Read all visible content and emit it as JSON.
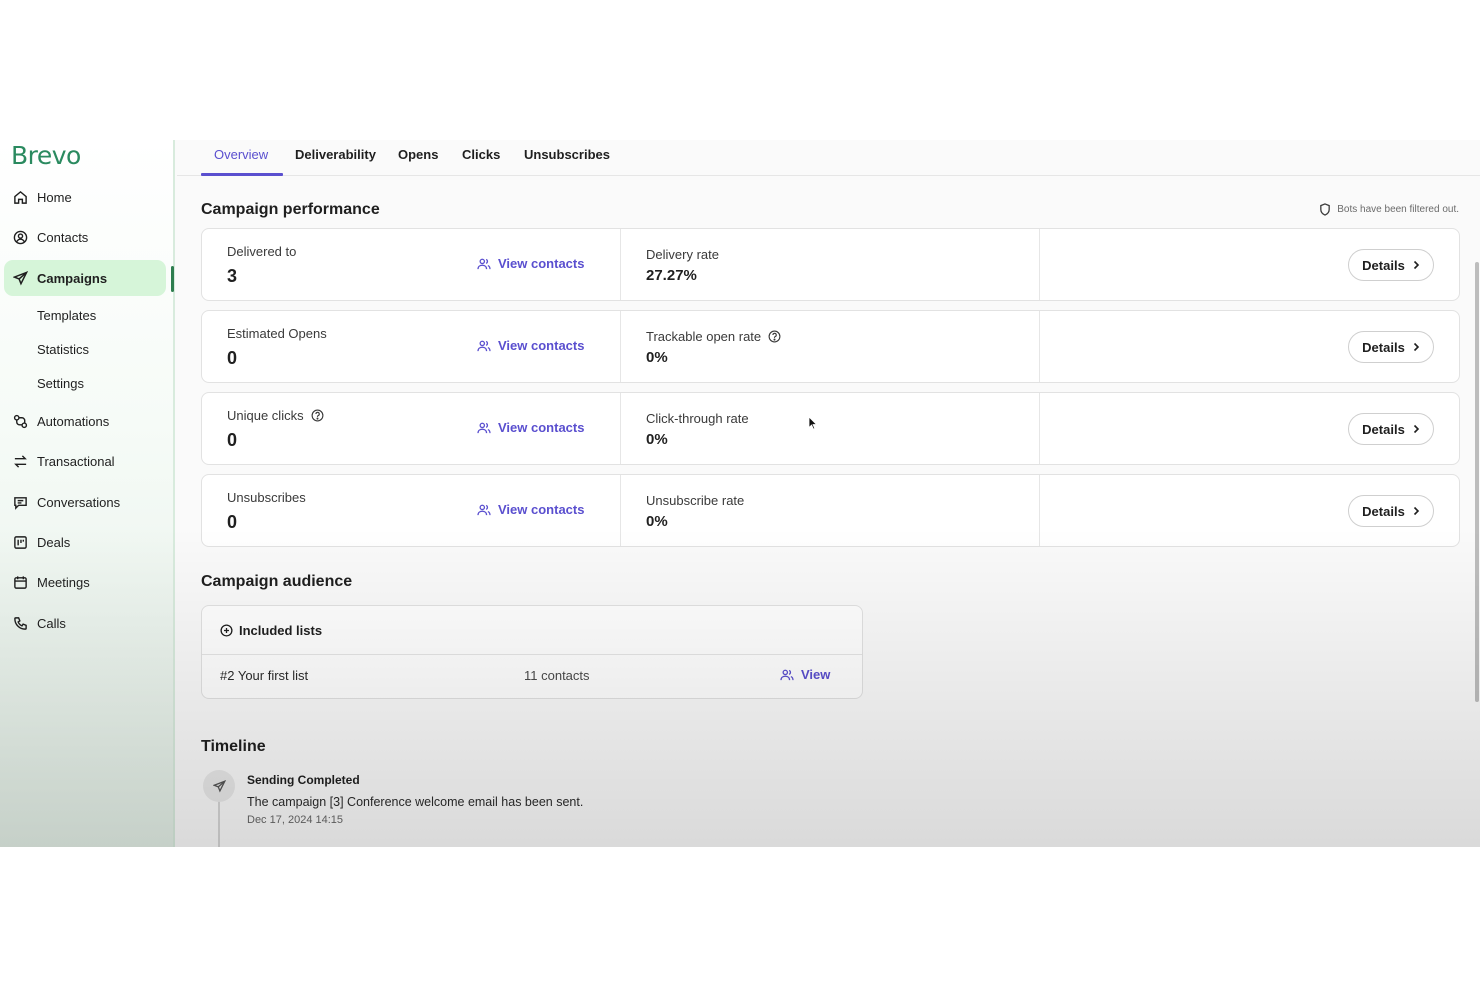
{
  "brand": {
    "logo_text": "Brevo",
    "color": "#2a8a5f"
  },
  "sidebar": {
    "items": [
      {
        "label": "Home",
        "icon": "home-icon"
      },
      {
        "label": "Contacts",
        "icon": "contacts-icon"
      },
      {
        "label": "Campaigns",
        "icon": "send-icon",
        "active": true
      },
      {
        "label": "Automations",
        "icon": "automations-icon"
      },
      {
        "label": "Transactional",
        "icon": "transactional-icon"
      },
      {
        "label": "Conversations",
        "icon": "conversations-icon"
      },
      {
        "label": "Deals",
        "icon": "deals-icon"
      },
      {
        "label": "Meetings",
        "icon": "calendar-icon"
      },
      {
        "label": "Calls",
        "icon": "phone-icon"
      }
    ],
    "sub_items": [
      "Templates",
      "Statistics",
      "Settings"
    ],
    "active_color": "#d6f5d9"
  },
  "tabs": [
    "Overview",
    "Deliverability",
    "Opens",
    "Clicks",
    "Unsubscribes"
  ],
  "accent_color": "#5a4fcf",
  "performance": {
    "title": "Campaign performance",
    "bots_note": "Bots have been filtered out.",
    "rows": [
      {
        "label": "Delivered to",
        "value": "3",
        "link": "View contacts",
        "rate_label": "Delivery rate",
        "rate_value": "27.27%",
        "details": "Details"
      },
      {
        "label": "Estimated Opens",
        "value": "0",
        "link": "View contacts",
        "rate_label": "Trackable open rate",
        "rate_value": "0%",
        "details": "Details"
      },
      {
        "label": "Unique clicks",
        "value": "0",
        "link": "View contacts",
        "rate_label": "Click-through rate",
        "rate_value": "0%",
        "details": "Details"
      },
      {
        "label": "Unsubscribes",
        "value": "0",
        "link": "View contacts",
        "rate_label": "Unsubscribe rate",
        "rate_value": "0%",
        "details": "Details"
      }
    ]
  },
  "audience": {
    "title": "Campaign audience",
    "header": "Included lists",
    "list_name": "#2 Your first list",
    "list_count": "11 contacts",
    "view_label": "View"
  },
  "timeline": {
    "title": "Timeline",
    "event_title": "Sending Completed",
    "event_text": "The campaign [3] Conference welcome email has been sent.",
    "event_date": "Dec 17, 2024 14:15"
  }
}
